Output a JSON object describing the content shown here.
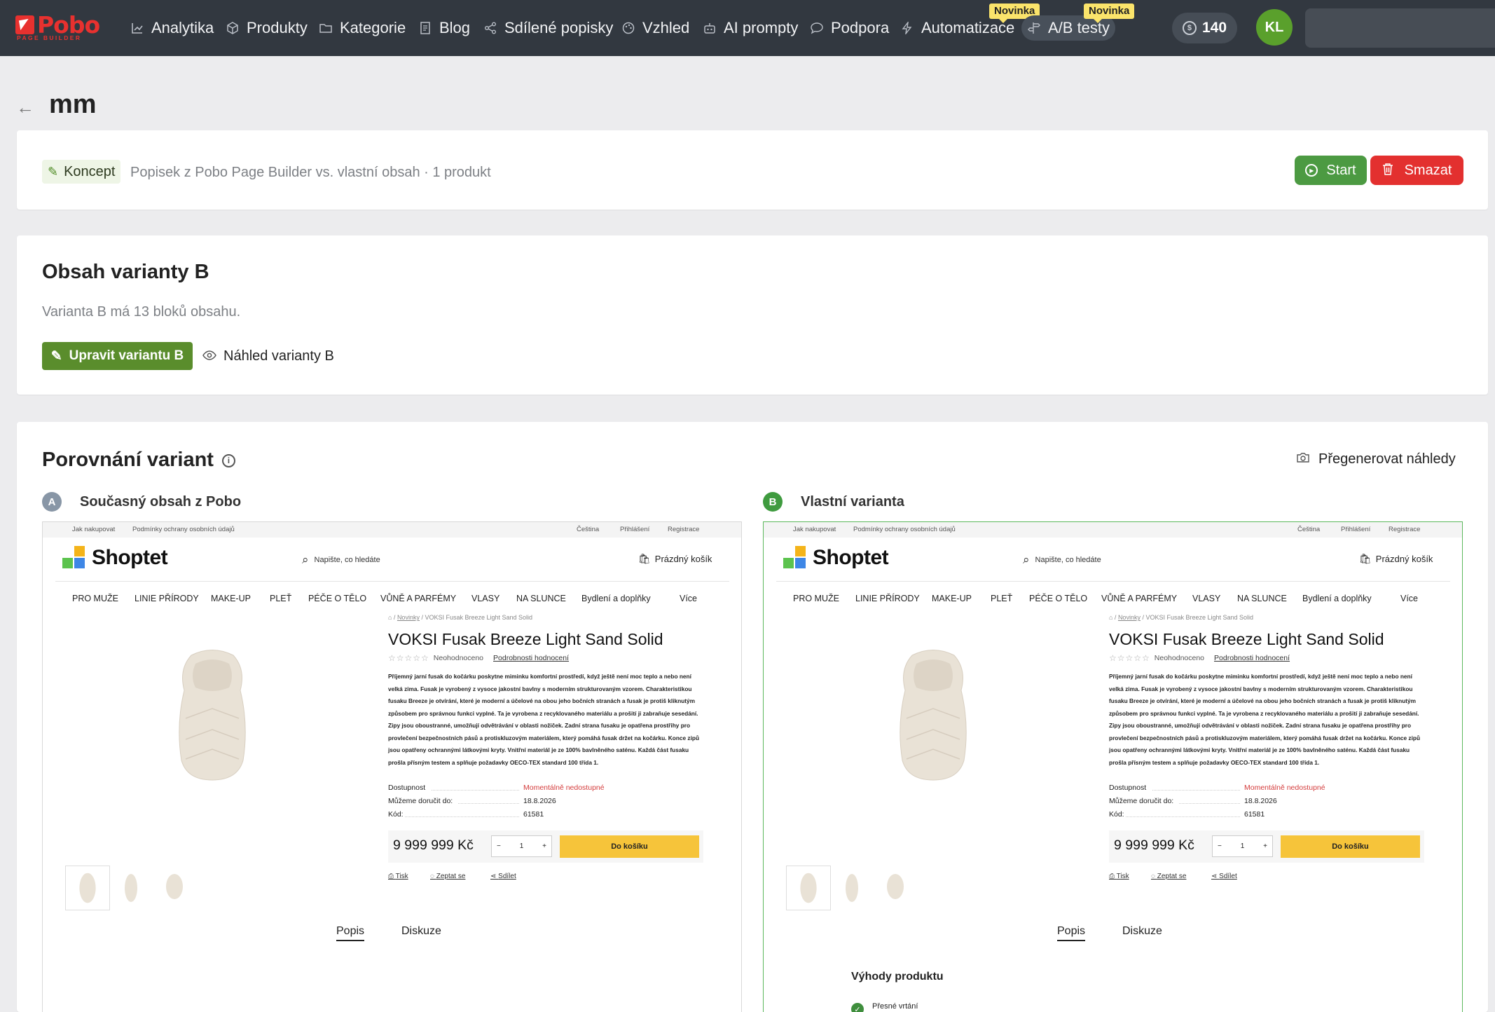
{
  "app": {
    "logo_text": "Pobo",
    "logo_sub": "PAGE BUILDER"
  },
  "nav": {
    "items": [
      {
        "label": "Analytika",
        "icon": "chart-line-icon"
      },
      {
        "label": "Produkty",
        "icon": "box-icon"
      },
      {
        "label": "Kategorie",
        "icon": "folder-icon"
      },
      {
        "label": "Blog",
        "icon": "document-icon"
      },
      {
        "label": "Sdílené popisky",
        "icon": "share-icon"
      },
      {
        "label": "Vzhled",
        "icon": "palette-icon"
      },
      {
        "label": "AI prompty",
        "icon": "robot-icon"
      },
      {
        "label": "Podpora",
        "icon": "chat-icon"
      },
      {
        "label": "Automatizace",
        "icon": "lightning-icon"
      },
      {
        "label": "A/B testy",
        "icon": "signpost-icon"
      }
    ],
    "badge_new": "Novinka",
    "credits": "140",
    "avatar": "KL"
  },
  "page": {
    "title": "mm"
  },
  "test_info": {
    "status": "Koncept",
    "meta": "Popisek z Pobo Page Builder vs. vlastní obsah · 1 produkt",
    "start_label": "Start",
    "delete_label": "Smazat"
  },
  "variant_b": {
    "heading": "Obsah varianty B",
    "description": "Varianta B má 13 bloků obsahu.",
    "edit_label": "Upravit variantu B",
    "preview_label": "Náhled varianty B"
  },
  "comparison": {
    "heading": "Porovnání variant",
    "regenerate_label": "Přegenerovat náhledy",
    "variant_a": {
      "letter": "A",
      "title": "Současný obsah z Pobo"
    },
    "variant_b": {
      "letter": "B",
      "title": "Vlastní varianta"
    }
  },
  "shop_preview": {
    "topbar_left1": "Jak nakupovat",
    "topbar_left2": "Podmínky ochrany osobních údajů",
    "topbar_lang": "Čeština",
    "topbar_login": "Přihlášení",
    "topbar_register": "Registrace",
    "logo": "Shoptet",
    "search_placeholder": "Napište, co hledáte",
    "cart": "Prázdný košík",
    "menu": [
      "PRO MUŽE",
      "LINIE PŘÍRODY",
      "MAKE-UP",
      "PLEŤ",
      "PÉČE O TĚLO",
      "VŮNĚ A PARFÉMY",
      "VLASY",
      "NA SLUNCE",
      "Bydlení a doplňky",
      "Více"
    ],
    "breadcrumb_link": "Novinky",
    "breadcrumb_current": "VOKSI Fusak Breeze Light Sand Solid",
    "product_title": "VOKSI Fusak Breeze Light Sand Solid",
    "rating_text": "Neohodnoceno",
    "rating_link": "Podrobnosti hodnocení",
    "description": "Příjemný jarní fusak do kočárku poskytne miminku komfortní prostředí, když ještě není moc teplo a nebo není velká zima. Fusak je vyrobený z vysoce jakostní bavlny s moderním strukturovaným vzorem. Charakteristikou fusaku Breeze je otvírání, které je moderní a účelové na obou jeho bočních stranách a fusak je protiš kliknutým způsobem pro správnou funkci vyplné. Ta je vyrobena z recyklovaného materiálu a prošití ji zabraňuje sesedání. Zipy jsou oboustranné, umožňují odvětrávání v oblasti nožiček. Zadní strana fusaku je opatřena prostřihy pro provlečení bezpečnostních pásů a protiskluzovým materiálem, který pomáhá fusak držet na kočárku. Konce zipů jsou opatřeny ochrannými látkovými kryty. Vnitřní materiál je ze 100% bavlněného saténu. Každá část fusaku prošla přísným testem a splňuje požadavky OECO-TEX standard 100 třída 1.",
    "availability_label": "Dostupnost",
    "availability_value": "Momentálně nedostupné",
    "delivery_label": "Můžeme doručit do:",
    "delivery_value": "18.8.2026",
    "code_label": "Kód:",
    "code_value": "61581",
    "price": "9 999 999 Kč",
    "qty": "1",
    "add_to_cart": "Do košíku",
    "link_print": "Tisk",
    "link_ask": "Zeptat se",
    "link_share": "Sdílet",
    "tab_description": "Popis",
    "tab_discussion": "Diskuze",
    "benefits_heading": "Výhody produktu",
    "benefit_1": "Přesné vrtání"
  }
}
